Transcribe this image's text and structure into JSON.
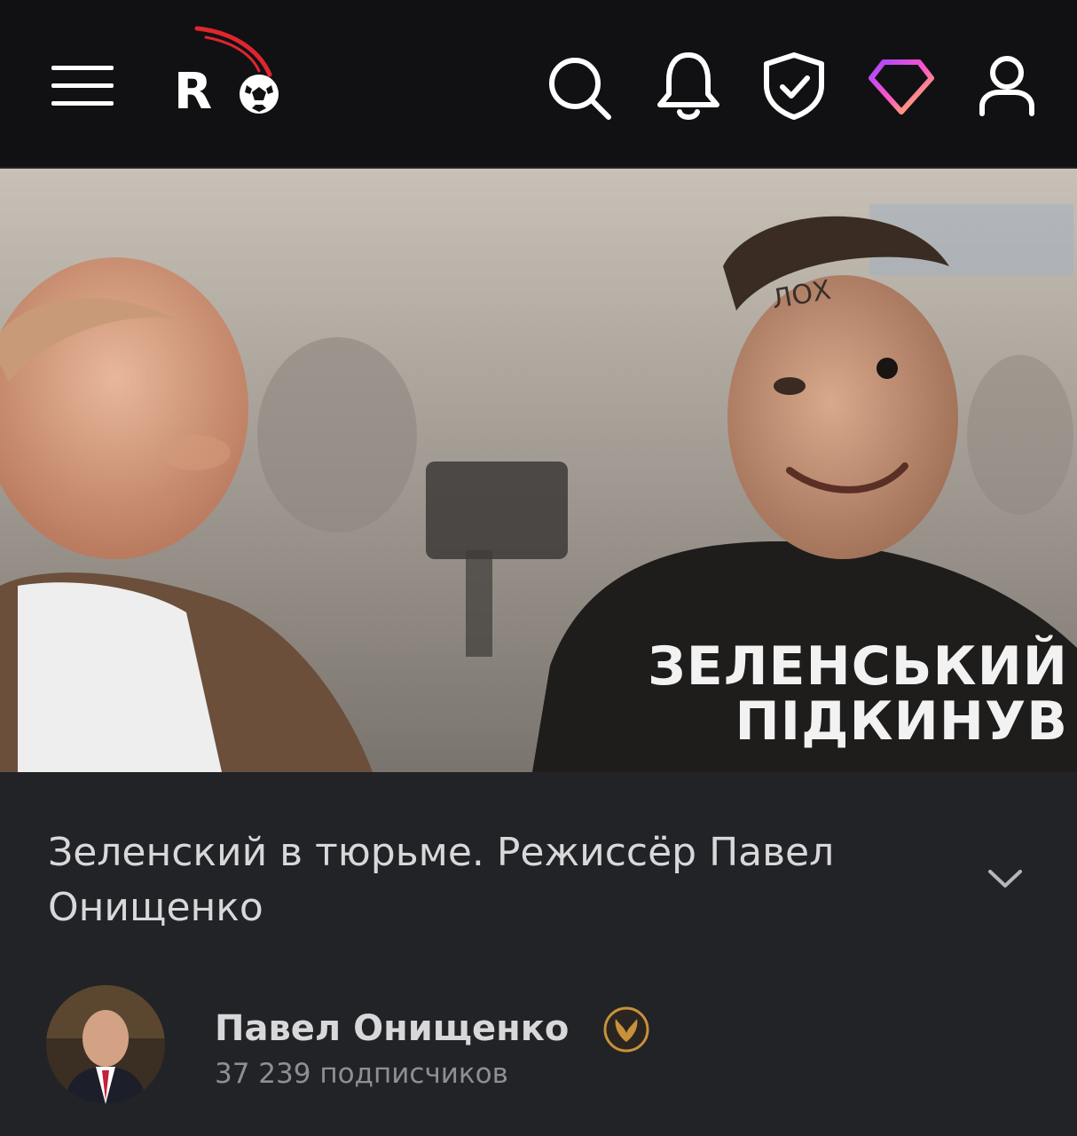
{
  "header": {
    "logo_text": "R",
    "icons": [
      "menu-icon",
      "logo",
      "search-icon",
      "bell-icon",
      "shield-icon",
      "diamond-icon",
      "user-icon"
    ]
  },
  "hero": {
    "forehead_text": "ЛОХ",
    "caption_line1": "ЗЕЛЕНСЬКИЙ",
    "caption_line2": "ПІДКИНУВ"
  },
  "post": {
    "title": "Зеленский в тюрьме. Режиссёр Павел Онищенко",
    "author": "Павел Онищенко",
    "subscribers": "37 239 подписчиков"
  },
  "colors": {
    "header_bg": "#111113",
    "page_bg": "#222327",
    "title_text": "#d8d8da",
    "muted_text": "#8e8f95",
    "logo_accent": "#e0252f",
    "badge_gold": "#c8913a"
  }
}
